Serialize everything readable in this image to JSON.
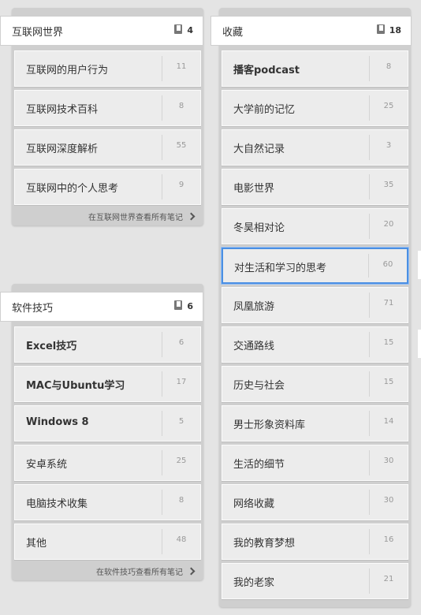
{
  "stacks": {
    "internet": {
      "title": "互联网世界",
      "count": "4",
      "footer": "在互联网世界查看所有笔记",
      "items": [
        {
          "label": "互联网的用户行为",
          "count": "11"
        },
        {
          "label": "互联网技术百科",
          "count": "8"
        },
        {
          "label": "互联网深度解析",
          "count": "55"
        },
        {
          "label": "互联网中的个人思考",
          "count": "9"
        }
      ]
    },
    "software": {
      "title": "软件技巧",
      "count": "6",
      "footer": "在软件技巧查看所有笔记",
      "items": [
        {
          "label": "Excel技巧",
          "count": "6"
        },
        {
          "label": "MAC与Ubuntu学习",
          "count": "17"
        },
        {
          "label": "Windows 8",
          "count": "5"
        },
        {
          "label": "安卓系统",
          "count": "25"
        },
        {
          "label": "电脑技术收集",
          "count": "8"
        },
        {
          "label": "其他",
          "count": "48"
        }
      ]
    },
    "favorites": {
      "title": "收藏",
      "count": "18",
      "items": [
        {
          "label": "播客podcast",
          "count": "8"
        },
        {
          "label": "大学前的记忆",
          "count": "25"
        },
        {
          "label": "大自然记录",
          "count": "3"
        },
        {
          "label": "电影世界",
          "count": "35"
        },
        {
          "label": "冬昊相对论",
          "count": "20"
        },
        {
          "label": "对生活和学习的思考",
          "count": "60",
          "selected": true
        },
        {
          "label": "凤凰旅游",
          "count": "71"
        },
        {
          "label": "交通路线",
          "count": "15"
        },
        {
          "label": "历史与社会",
          "count": "15"
        },
        {
          "label": "男士形象资料库",
          "count": "14"
        },
        {
          "label": "生活的细节",
          "count": "30"
        },
        {
          "label": "网络收藏",
          "count": "30"
        },
        {
          "label": "我的教育梦想",
          "count": "16"
        },
        {
          "label": "我的老家",
          "count": "21"
        }
      ]
    }
  }
}
